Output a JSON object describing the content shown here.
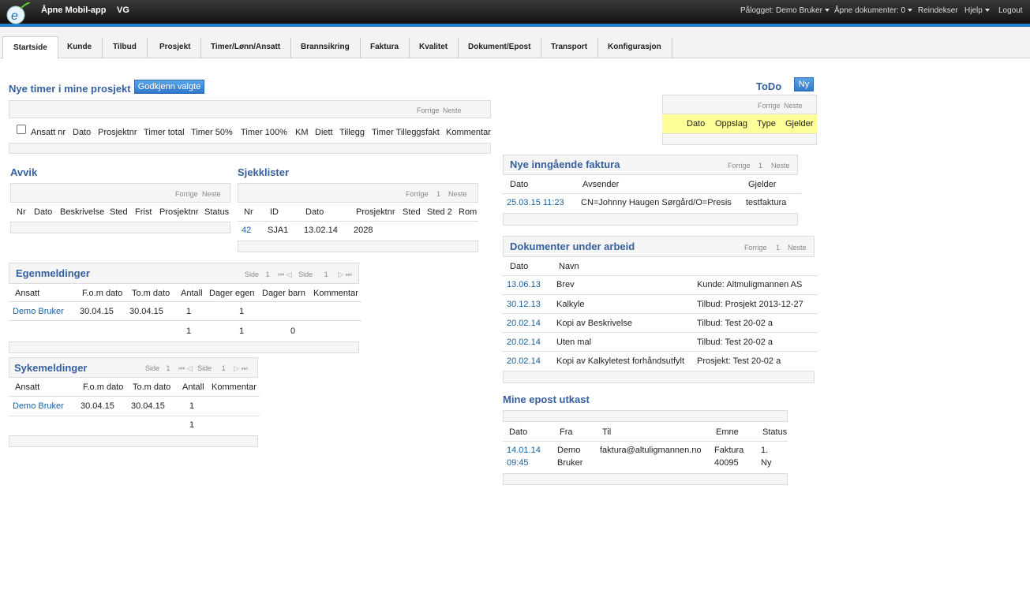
{
  "header": {
    "app_title": "Åpne Mobil-app",
    "vg": "VG",
    "logged_in": "Pålogget: Demo Bruker",
    "open_docs": "Åpne dokumenter: 0",
    "reindex": "Reindekser",
    "help": "Hjelp",
    "logout": "Logout"
  },
  "tabs": [
    "Startside",
    "Kunde",
    "Tilbud",
    "Prosjekt",
    "Timer/Lønn/Ansatt",
    "Brannsikring",
    "Faktura",
    "Kvalitet",
    "Dokument/Epost",
    "Transport",
    "Konfigurasjon"
  ],
  "timer": {
    "title": "Nye timer i mine prosjekt",
    "approve_button": "Godkjenn valgte",
    "prev": "Forrige",
    "next": "Neste",
    "columns": [
      "Ansatt nr",
      "Dato",
      "Prosjektnr",
      "Timer total",
      "Timer 50%",
      "Timer 100%",
      "KM",
      "Diett",
      "Tillegg",
      "Timer Tilleggsfakt",
      "Kommentar"
    ]
  },
  "todo": {
    "title": "ToDo",
    "new_button": "Ny",
    "prev": "Forrige",
    "next": "Neste",
    "columns": [
      "Dato",
      "Oppslag",
      "Type",
      "Gjelder"
    ]
  },
  "avvik": {
    "title": "Avvik",
    "prev": "Forrige",
    "next": "Neste",
    "columns": [
      "Nr",
      "Dato",
      "Beskrivelse",
      "Sted",
      "Frist",
      "Prosjektnr",
      "Status"
    ]
  },
  "sjekklister": {
    "title": "Sjekklister",
    "prev": "Forrige",
    "page": "1",
    "next": "Neste",
    "columns": [
      "Nr",
      "ID",
      "Dato",
      "Prosjektnr",
      "Sted",
      "Sted 2",
      "Rom"
    ],
    "rows": [
      [
        "42",
        "SJA1",
        "13.02.14",
        "2028"
      ]
    ]
  },
  "faktura": {
    "title": "Nye inngående faktura",
    "prev": "Forrige",
    "page": "1",
    "next": "Neste",
    "columns": [
      "Dato",
      "Avsender",
      "Gjelder"
    ],
    "rows": [
      [
        "25.03.15 11:23",
        "CN=Johnny Haugen Sørgård/O=Presis",
        "testfaktura"
      ]
    ]
  },
  "egenmeldinger": {
    "title": "Egenmeldinger",
    "side_label": "Side",
    "page": "1",
    "side_label2": "Side",
    "page2": "1",
    "columns": [
      "Ansatt",
      "F.o.m dato",
      "To.m dato",
      "Antall",
      "Dager egen",
      "Dager barn",
      "Kommentar"
    ],
    "rows": [
      [
        "Demo Bruker",
        "30.04.15",
        "30.04.15",
        "1",
        "1"
      ]
    ],
    "totals": [
      "1",
      "1",
      "0"
    ]
  },
  "sykemeldinger": {
    "title": "Sykemeldinger",
    "side_label": "Side",
    "page": "1",
    "side_label2": "Side",
    "page2": "1",
    "columns": [
      "Ansatt",
      "F.o.m dato",
      "To.m dato",
      "Antall",
      "Kommentar"
    ],
    "rows": [
      [
        "Demo Bruker",
        "30.04.15",
        "30.04.15",
        "1"
      ]
    ],
    "totals": [
      "1"
    ]
  },
  "dokumenter": {
    "title": "Dokumenter under arbeid",
    "prev": "Forrige",
    "page": "1",
    "next": "Neste",
    "columns": [
      "Dato",
      "Navn"
    ],
    "rows": [
      [
        "13.06.13",
        "Brev",
        "Kunde: Altmuligmannen AS"
      ],
      [
        "30.12.13",
        "Kalkyle",
        "Tilbud: Prosjekt 2013-12-27"
      ],
      [
        "20.02.14",
        "Kopi av Beskrivelse",
        "Tilbud: Test 20-02 a"
      ],
      [
        "20.02.14",
        "Uten mal",
        "Tilbud: Test 20-02 a"
      ],
      [
        "20.02.14",
        "Kopi av Kalkyletest forhåndsutfylt",
        "Prosjekt: Test 20-02 a"
      ]
    ]
  },
  "epost": {
    "title": "Mine epost utkast",
    "columns": [
      "Dato",
      "Fra",
      "Til",
      "Emne",
      "Status"
    ],
    "row": {
      "date1": "14.01.14",
      "date2": "09:45",
      "from1": "Demo",
      "from2": "Bruker",
      "to": "faktura@altuligmannen.no",
      "subject1": "Faktura",
      "subject2": "40095",
      "status1": "1.",
      "status2": "Ny"
    }
  },
  "colors": {
    "accent": "#355f9e",
    "link": "#1a5f9e",
    "topbar": "#1c1c1c",
    "blue_line": "#1f7fc8",
    "todo_header_bg": "#ffff99"
  }
}
